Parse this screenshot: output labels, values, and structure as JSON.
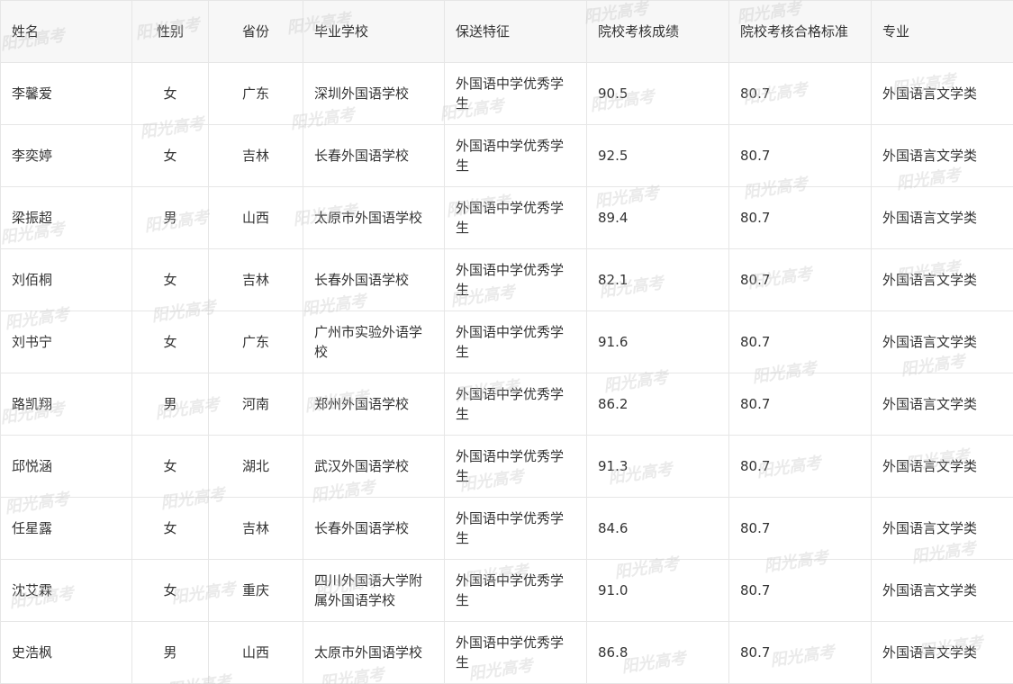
{
  "watermark": "阳光高考",
  "table": {
    "headers": [
      "姓名",
      "性别",
      "省份",
      "毕业学校",
      "保送特征",
      "院校考核成绩",
      "院校考核合格标准",
      "专业"
    ],
    "rows": [
      [
        "李馨爱",
        "女",
        "广东",
        "深圳外国语学校",
        "外国语中学优秀学生",
        "90.5",
        "80.7",
        "外国语言文学类"
      ],
      [
        "李奕婷",
        "女",
        "吉林",
        "长春外国语学校",
        "外国语中学优秀学生",
        "92.5",
        "80.7",
        "外国语言文学类"
      ],
      [
        "梁振超",
        "男",
        "山西",
        "太原市外国语学校",
        "外国语中学优秀学生",
        "89.4",
        "80.7",
        "外国语言文学类"
      ],
      [
        "刘佰桐",
        "女",
        "吉林",
        "长春外国语学校",
        "外国语中学优秀学生",
        "82.1",
        "80.7",
        "外国语言文学类"
      ],
      [
        "刘书宁",
        "女",
        "广东",
        "广州市实验外语学校",
        "外国语中学优秀学生",
        "91.6",
        "80.7",
        "外国语言文学类"
      ],
      [
        "路凯翔",
        "男",
        "河南",
        "郑州外国语学校",
        "外国语中学优秀学生",
        "86.2",
        "80.7",
        "外国语言文学类"
      ],
      [
        "邱悦涵",
        "女",
        "湖北",
        "武汉外国语学校",
        "外国语中学优秀学生",
        "91.3",
        "80.7",
        "外国语言文学类"
      ],
      [
        "任星露",
        "女",
        "吉林",
        "长春外国语学校",
        "外国语中学优秀学生",
        "84.6",
        "80.7",
        "外国语言文学类"
      ],
      [
        "沈艾霖",
        "女",
        "重庆",
        "四川外国语大学附属外国语学校",
        "外国语中学优秀学生",
        "91.0",
        "80.7",
        "外国语言文学类"
      ],
      [
        "史浩枫",
        "男",
        "山西",
        "太原市外国语学校",
        "外国语中学优秀学生",
        "86.8",
        "80.7",
        "外国语言文学类"
      ]
    ]
  }
}
